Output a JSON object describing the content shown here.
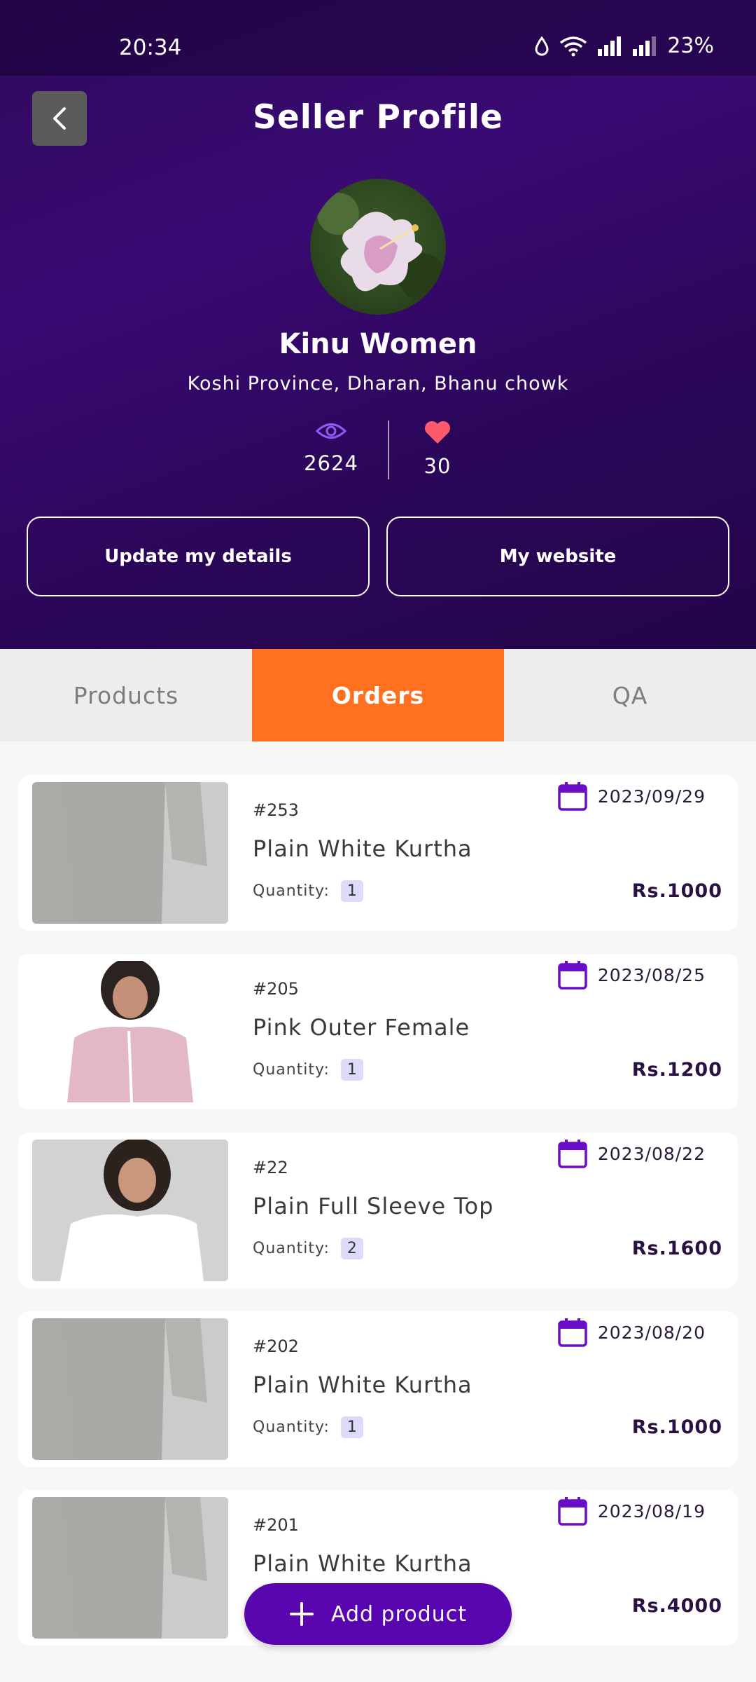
{
  "status_bar": {
    "time": "20:34",
    "battery": "23%"
  },
  "header": {
    "title": "Seller Profile",
    "seller_name": "Kinu Women",
    "location": "Koshi Province, Dharan, Bhanu chowk",
    "views": "2624",
    "likes": "30",
    "update_button": "Update my details",
    "website_button": "My website"
  },
  "tabs": [
    {
      "label": "Products",
      "active": false
    },
    {
      "label": "Orders",
      "active": true
    },
    {
      "label": "QA",
      "active": false
    }
  ],
  "orders": [
    {
      "id": "#253",
      "title": "Plain White Kurtha",
      "date": "2023/09/29",
      "qty_label": "Quantity:",
      "qty": "1",
      "price": "Rs.1000",
      "image": "white-kurtha"
    },
    {
      "id": "#205",
      "title": "Pink Outer Female",
      "date": "2023/08/25",
      "qty_label": "Quantity:",
      "qty": "1",
      "price": "Rs.1200",
      "image": "pink-outer"
    },
    {
      "id": "#22",
      "title": "Plain Full Sleeve Top",
      "date": "2023/08/22",
      "qty_label": "Quantity:",
      "qty": "2",
      "price": "Rs.1600",
      "image": "white-top"
    },
    {
      "id": "#202",
      "title": "Plain White Kurtha",
      "date": "2023/08/20",
      "qty_label": "Quantity:",
      "qty": "1",
      "price": "Rs.1000",
      "image": "white-kurtha"
    },
    {
      "id": "#201",
      "title": "Plain White Kurtha",
      "date": "2023/08/19",
      "qty_label": "Quantity:",
      "qty": "",
      "price": "Rs.4000",
      "image": "white-kurtha"
    }
  ],
  "fab": {
    "label": "Add product"
  },
  "colors": {
    "header_bg": "#2e0a5c",
    "accent_tab": "#ff7120",
    "fab": "#5a06b0",
    "calendar": "#6a0dc9",
    "heart": "#ff5a6a",
    "eye": "#8a5cf0"
  }
}
